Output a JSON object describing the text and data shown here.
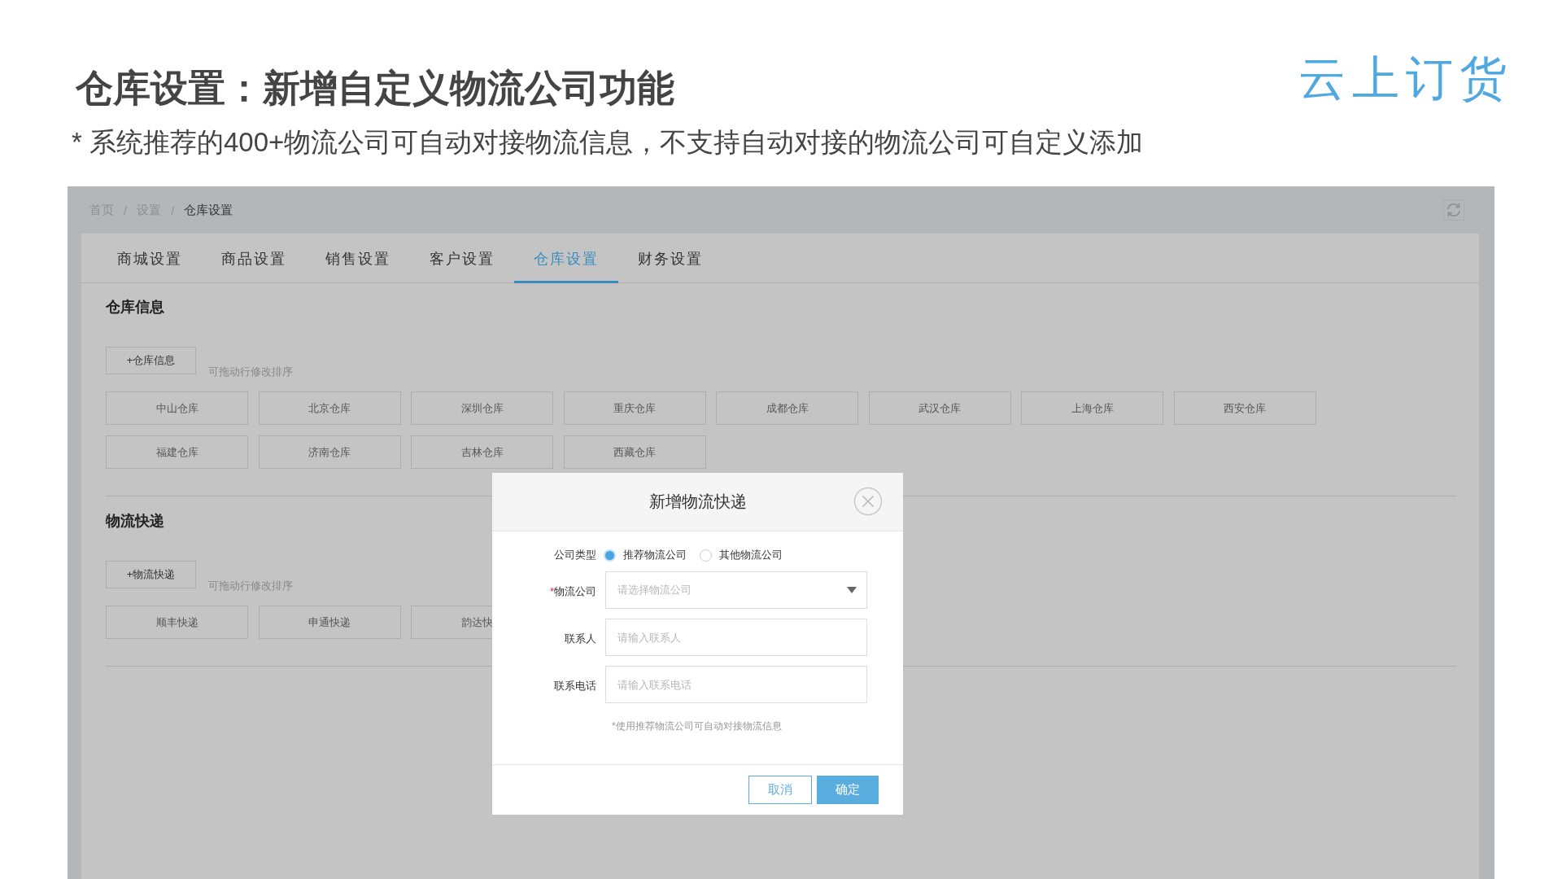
{
  "slide": {
    "title": "仓库设置：新增自定义物流公司功能",
    "subtitle": "* 系统推荐的400+物流公司可自动对接物流信息，不支持自动对接的物流公司可自定义添加",
    "logo": "云上订货"
  },
  "breadcrumb": [
    {
      "kind": "link",
      "text": "首页"
    },
    {
      "kind": "separator",
      "text": "/"
    },
    {
      "kind": "link",
      "text": "设置"
    },
    {
      "kind": "separator",
      "text": "/"
    },
    {
      "kind": "current",
      "text": "仓库设置"
    }
  ],
  "tabs": [
    {
      "label": "商城设置",
      "selected": false
    },
    {
      "label": "商品设置",
      "selected": false
    },
    {
      "label": "销售设置",
      "selected": false
    },
    {
      "label": "客户设置",
      "selected": false
    },
    {
      "label": "仓库设置",
      "selected": true
    },
    {
      "label": "财务设置",
      "selected": false
    }
  ],
  "sections": [
    {
      "title": "仓库信息",
      "add_button": "+仓库信息",
      "hint": "可拖动行修改排序",
      "items": [
        "中山仓库",
        "北京仓库",
        "深圳仓库",
        "重庆仓库",
        "成都仓库",
        "武汉仓库",
        "上海仓库",
        "西安仓库",
        "福建仓库",
        "济南仓库",
        "吉林仓库",
        "西藏仓库"
      ]
    },
    {
      "title": "物流快递",
      "add_button": "+物流快递",
      "hint": "可拖动行修改排序",
      "items": [
        "顺丰快递",
        "申通快递",
        "韵达快"
      ]
    }
  ],
  "dialog": {
    "title": "新增物流快递",
    "type_label": "公司类型",
    "type_options": [
      {
        "label": "推荐物流公司",
        "selected": true
      },
      {
        "label": "其他物流公司",
        "selected": false
      }
    ],
    "fields": [
      {
        "kind": "select",
        "required_mark": "*",
        "label": "物流公司",
        "placeholder": "请选择物流公司"
      },
      {
        "kind": "text",
        "label": "联系人",
        "placeholder": "请输入联系人"
      },
      {
        "kind": "text",
        "label": "联系电话",
        "placeholder": "请输入联系电话"
      }
    ],
    "note": "*使用推荐物流公司可自动对接物流信息",
    "buttons": [
      {
        "kind": "secondary",
        "label": "取消"
      },
      {
        "kind": "primary",
        "label": "确定"
      }
    ]
  }
}
